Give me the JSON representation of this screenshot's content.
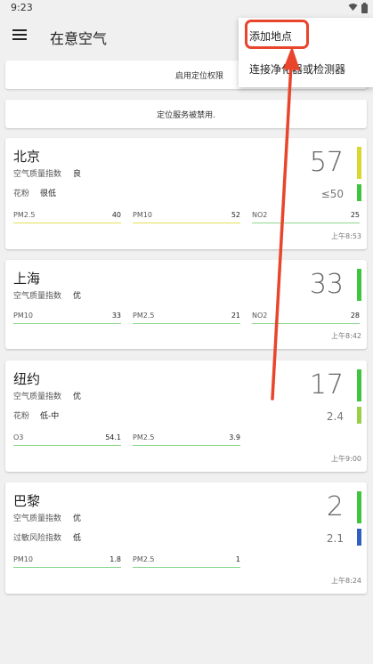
{
  "status_bar": {
    "time": "9:23"
  },
  "app_bar": {
    "title": "在意空气"
  },
  "banners": {
    "enable_location": "启用定位权限",
    "location_disabled": "定位服务被禁用."
  },
  "popup_menu": {
    "items": [
      "添加地点",
      "连接净化器或检测器"
    ]
  },
  "cards": [
    {
      "city": "北京",
      "aqi_label": "空气质量指数",
      "aqi_value": "良",
      "aqi_number": "57",
      "secondary_label": "花粉",
      "secondary_value": "很低",
      "secondary_number": "≤50",
      "metrics": [
        {
          "name": "PM2.5",
          "value": "40"
        },
        {
          "name": "PM10",
          "value": "52"
        },
        {
          "name": "NO2",
          "value": "25"
        }
      ],
      "time": "上午8:53",
      "colors": {
        "main_bar": "#d9d62f",
        "secondary_bar": "#3ec43e"
      }
    },
    {
      "city": "上海",
      "aqi_label": "空气质量指数",
      "aqi_value": "优",
      "aqi_number": "33",
      "metrics": [
        {
          "name": "PM10",
          "value": "33"
        },
        {
          "name": "PM2.5",
          "value": "21"
        },
        {
          "name": "NO2",
          "value": "28"
        }
      ],
      "time": "上午8:42",
      "colors": {
        "main_bar": "#3ec43e"
      }
    },
    {
      "city": "纽约",
      "aqi_label": "空气质量指数",
      "aqi_value": "优",
      "aqi_number": "17",
      "secondary_label": "花粉",
      "secondary_value": "低-中",
      "secondary_number": "2.4",
      "metrics": [
        {
          "name": "O3",
          "value": "54.1"
        },
        {
          "name": "PM2.5",
          "value": "3.9"
        }
      ],
      "time": "上午9:00",
      "colors": {
        "main_bar": "#3ec43e",
        "secondary_bar": "#9ad048"
      }
    },
    {
      "city": "巴黎",
      "aqi_label": "空气质量指数",
      "aqi_value": "优",
      "aqi_number": "2",
      "secondary_label": "过敏风险指数",
      "secondary_value": "低",
      "secondary_number": "2.1",
      "metrics": [
        {
          "name": "PM10",
          "value": "1.8"
        },
        {
          "name": "PM2.5",
          "value": "1"
        }
      ],
      "time": "上午8:24",
      "colors": {
        "main_bar": "#3ec43e",
        "secondary_bar": "#2f5fbf"
      }
    }
  ],
  "colors": {
    "annotation_red": "#e8452c",
    "metric_line_green": "#8fd88f",
    "metric_line_yellow": "#e6e05a"
  },
  "icons": [
    "menu-icon",
    "wifi-icon",
    "battery-icon"
  ]
}
